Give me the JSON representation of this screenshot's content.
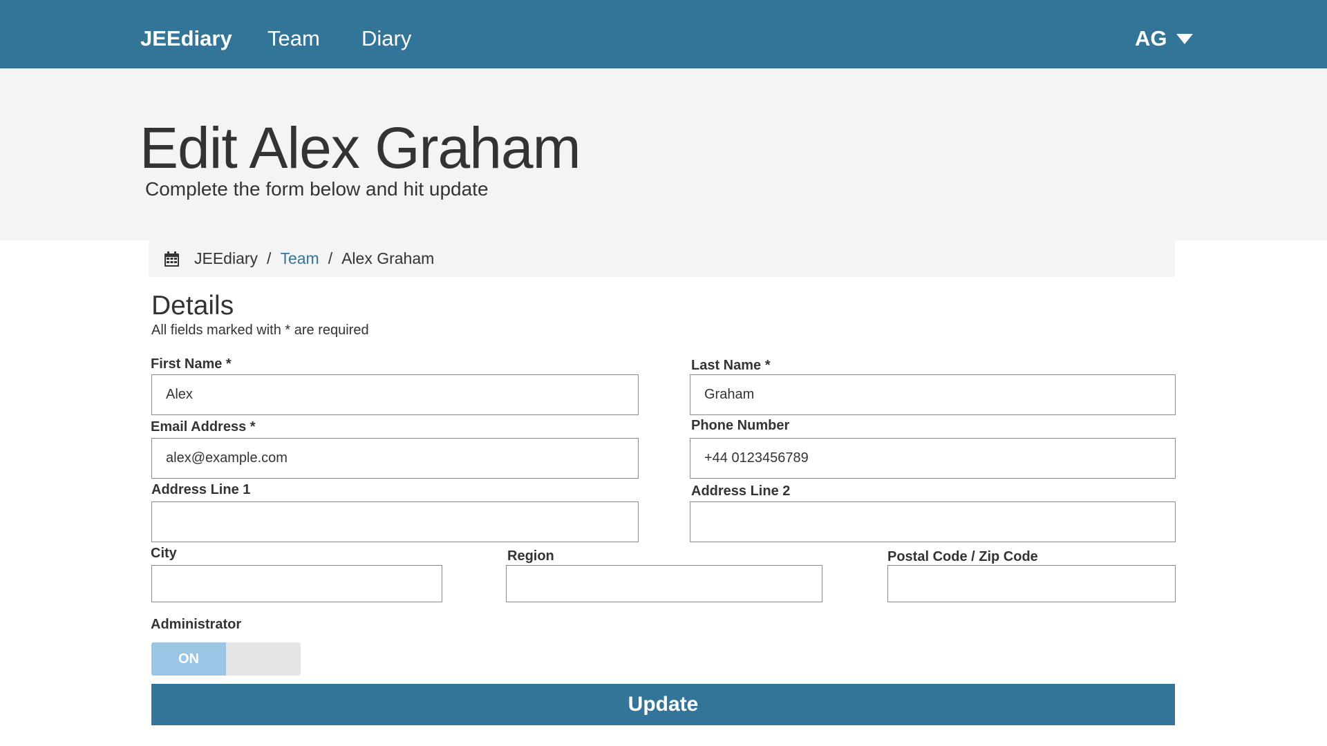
{
  "nav": {
    "brand": "JEEdiary",
    "links": [
      "Team",
      "Diary"
    ],
    "user_initials": "AG"
  },
  "header": {
    "title": "Edit Alex Graham",
    "subtitle": "Complete the form below and hit update"
  },
  "breadcrumb": {
    "icon": "calendar-icon",
    "items": [
      "JEEdiary",
      "Team",
      "Alex Graham"
    ],
    "separator": "/"
  },
  "form": {
    "section_title": "Details",
    "required_note": "All fields marked with * are required",
    "fields": {
      "first_name": {
        "label": "First Name *",
        "value": "Alex"
      },
      "last_name": {
        "label": "Last Name *",
        "value": "Graham"
      },
      "email": {
        "label": "Email Address *",
        "value": "alex@example.com"
      },
      "phone": {
        "label": "Phone Number",
        "value": "+44 0123456789"
      },
      "address1": {
        "label": "Address Line 1",
        "value": ""
      },
      "address2": {
        "label": "Address Line 2",
        "value": ""
      },
      "city": {
        "label": "City",
        "value": ""
      },
      "region": {
        "label": "Region",
        "value": ""
      },
      "postal": {
        "label": "Postal Code / Zip Code",
        "value": ""
      }
    },
    "administrator": {
      "label": "Administrator",
      "state": "ON"
    },
    "submit_label": "Update"
  },
  "colors": {
    "primary": "#337599",
    "toggle_on": "#9ac5e3",
    "jumbotron_bg": "#f4f4f4"
  }
}
